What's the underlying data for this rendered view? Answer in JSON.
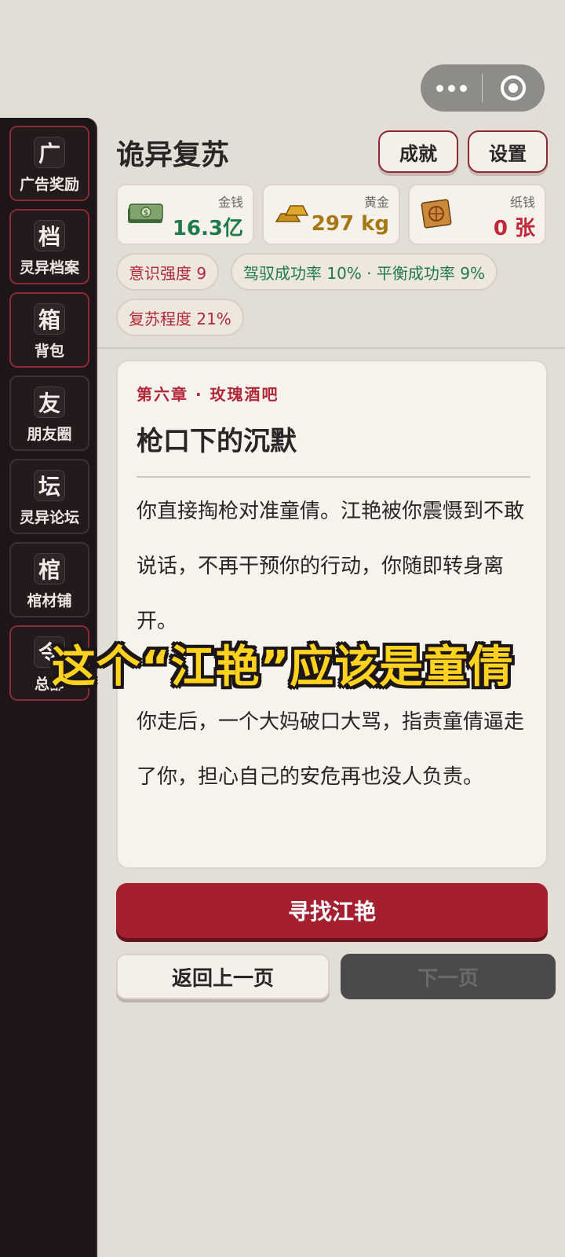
{
  "app": {
    "title": "诡异复苏"
  },
  "header": {
    "achievements_label": "成就",
    "settings_label": "设置"
  },
  "sidebar": {
    "items": [
      {
        "glyph": "广",
        "label": "广告奖励"
      },
      {
        "glyph": "档",
        "label": "灵异档案"
      },
      {
        "glyph": "箱",
        "label": "背包"
      },
      {
        "glyph": "友",
        "label": "朋友圈"
      },
      {
        "glyph": "坛",
        "label": "灵异论坛"
      },
      {
        "glyph": "棺",
        "label": "棺材铺"
      },
      {
        "glyph": "令",
        "label": "总部"
      }
    ]
  },
  "resources": [
    {
      "label": "金钱",
      "value": "16.3亿",
      "icon": "money-stack-icon",
      "color": "#1f7a4a"
    },
    {
      "label": "黄金",
      "value": "297 kg",
      "icon": "gold-bar-icon",
      "color": "#a67814"
    },
    {
      "label": "纸钱",
      "value": "0 张",
      "icon": "paper-money-icon",
      "color": "#c0283a"
    }
  ],
  "stats": {
    "consciousness": "意识强度 9",
    "control_balance": "驾驭成功率 10% · 平衡成功率 9%",
    "revival": "复苏程度 21%"
  },
  "story": {
    "chapter": "第六章 · 玫瑰酒吧",
    "title": "枪口下的沉默",
    "paragraph1": "你直接掏枪对准童倩。江艳被你震慑到不敢说话，不再干预你的行动，你随即转身离开。",
    "paragraph2": "你走后，一个大妈破口大骂，指责童倩逼走了你，担心自己的安危再也没人负责。"
  },
  "overlay": {
    "caption": "这个“江艳”应该是童倩"
  },
  "actions": {
    "primary": "寻找江艳",
    "back": "返回上一页",
    "next": "下一页"
  },
  "colors": {
    "accent": "#a41f30",
    "sidebar_bg": "#1d1517",
    "page_bg": "#e2ded5",
    "caption": "#ffd21f"
  }
}
